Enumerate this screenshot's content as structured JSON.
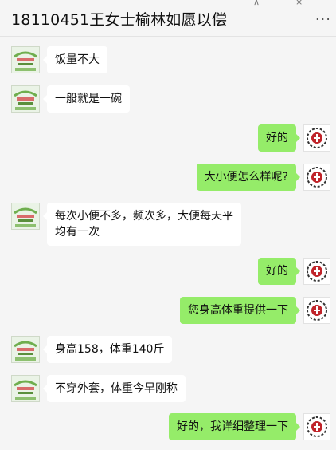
{
  "chat": {
    "title": "18110451王女士榆林如愿以偿",
    "more_icon": "more-dots-icon",
    "top_icons": [
      "pin-icon",
      "close-icon"
    ]
  },
  "messages": [
    {
      "side": "in",
      "lines": [
        "饭量不大"
      ]
    },
    {
      "side": "in",
      "lines": [
        "一般就是一碗"
      ]
    },
    {
      "side": "out",
      "lines": [
        "好的"
      ]
    },
    {
      "side": "out",
      "lines": [
        "大小便怎么样呢?"
      ]
    },
    {
      "side": "in",
      "lines": [
        "每次小便不多，频次多，大便每天平",
        "均有一次"
      ]
    },
    {
      "side": "out",
      "lines": [
        "好的"
      ]
    },
    {
      "side": "out",
      "lines": [
        "您身高体重提供一下"
      ]
    },
    {
      "side": "in",
      "lines": [
        "身高158，体重140斤"
      ]
    },
    {
      "side": "in",
      "lines": [
        "不穿外套，体重今早刚称"
      ]
    },
    {
      "side": "out",
      "lines": [
        "好的，我详细整理一下"
      ]
    }
  ],
  "colors": {
    "background": "#f5f5f5",
    "incoming_bubble": "#ffffff",
    "outgoing_bubble": "#95ec69",
    "avatar_accent": "#c0242a"
  }
}
